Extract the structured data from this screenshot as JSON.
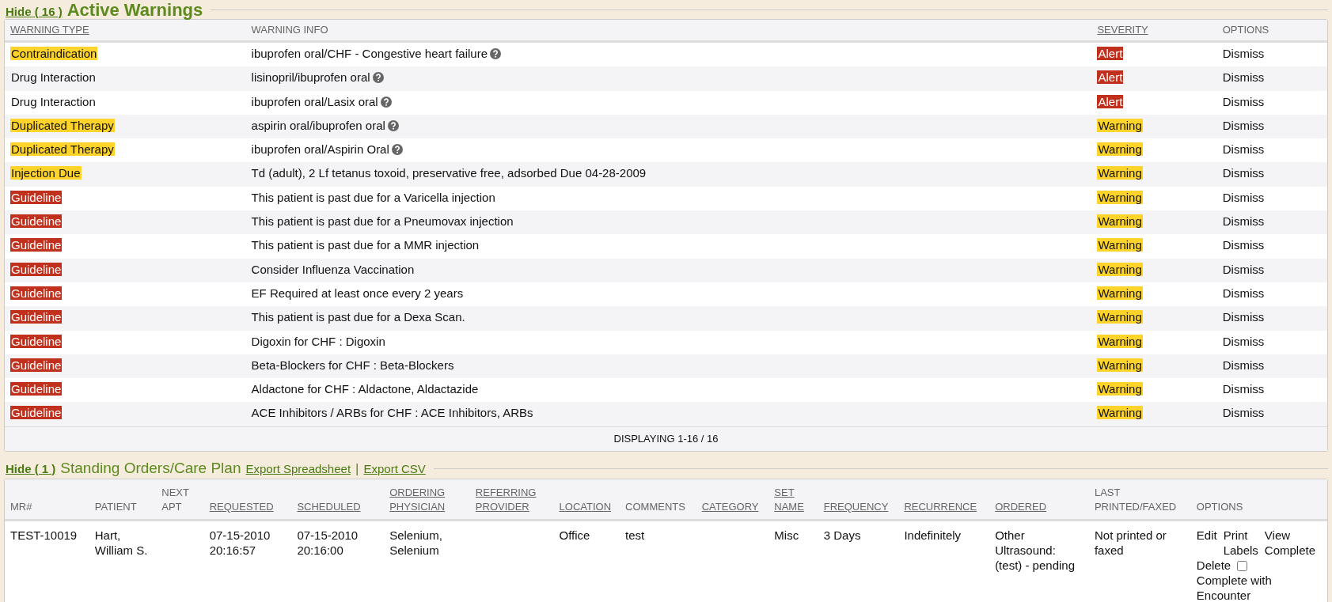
{
  "warnings": {
    "hide_link": "Hide ( 16 )",
    "title": "Active Warnings",
    "columns": [
      {
        "label": "WARNING TYPE",
        "sortable": true
      },
      {
        "label": "WARNING INFO",
        "sortable": false
      },
      {
        "label": "SEVERITY",
        "sortable": true
      },
      {
        "label": "OPTIONS",
        "sortable": false
      }
    ],
    "rows": [
      {
        "type": {
          "text": "Contraindication",
          "color": "#ffd42a"
        },
        "info": "ibuprofen oral/CHF - Congestive heart failure",
        "help": true,
        "severity": {
          "text": "Alert",
          "color": "#c0301c"
        },
        "option": "Dismiss"
      },
      {
        "type": {
          "text": "Drug Interaction"
        },
        "info": "lisinopril/ibuprofen oral",
        "help": true,
        "severity": {
          "text": "Alert",
          "color": "#c0301c"
        },
        "option": "Dismiss"
      },
      {
        "type": {
          "text": "Drug Interaction"
        },
        "info": "ibuprofen oral/Lasix oral",
        "help": true,
        "severity": {
          "text": "Alert",
          "color": "#c0301c"
        },
        "option": "Dismiss"
      },
      {
        "type": {
          "text": "Duplicated Therapy",
          "color": "#ffd42a"
        },
        "info": "aspirin oral/ibuprofen oral",
        "help": true,
        "severity": {
          "text": "Warning",
          "color": "#ffd42a"
        },
        "option": "Dismiss"
      },
      {
        "type": {
          "text": "Duplicated Therapy",
          "color": "#ffd42a"
        },
        "info": "ibuprofen oral/Aspirin Oral",
        "help": true,
        "severity": {
          "text": "Warning",
          "color": "#ffd42a"
        },
        "option": "Dismiss"
      },
      {
        "type": {
          "text": "Injection Due",
          "color": "#ffd42a"
        },
        "info": "Td (adult), 2 Lf tetanus toxoid, preservative free, adsorbed Due 04-28-2009",
        "help": false,
        "severity": {
          "text": "Warning",
          "color": "#ffd42a"
        },
        "option": "Dismiss"
      },
      {
        "type": {
          "text": "Guideline",
          "color": "#c0301c"
        },
        "info": "This patient is past due for a Varicella injection",
        "help": false,
        "severity": {
          "text": "Warning",
          "color": "#ffd42a"
        },
        "option": "Dismiss"
      },
      {
        "type": {
          "text": "Guideline",
          "color": "#c0301c"
        },
        "info": "This patient is past due for a Pneumovax injection",
        "help": false,
        "severity": {
          "text": "Warning",
          "color": "#ffd42a"
        },
        "option": "Dismiss"
      },
      {
        "type": {
          "text": "Guideline",
          "color": "#c0301c"
        },
        "info": "This patient is past due for a MMR injection",
        "help": false,
        "severity": {
          "text": "Warning",
          "color": "#ffd42a"
        },
        "option": "Dismiss"
      },
      {
        "type": {
          "text": "Guideline",
          "color": "#c0301c"
        },
        "info": "Consider Influenza Vaccination",
        "help": false,
        "severity": {
          "text": "Warning",
          "color": "#ffd42a"
        },
        "option": "Dismiss"
      },
      {
        "type": {
          "text": "Guideline",
          "color": "#c0301c"
        },
        "info": "EF Required at least once every 2 years",
        "help": false,
        "severity": {
          "text": "Warning",
          "color": "#ffd42a"
        },
        "option": "Dismiss"
      },
      {
        "type": {
          "text": "Guideline",
          "color": "#c0301c"
        },
        "info": "This patient is past due for a Dexa Scan.",
        "help": false,
        "severity": {
          "text": "Warning",
          "color": "#ffd42a"
        },
        "option": "Dismiss"
      },
      {
        "type": {
          "text": "Guideline",
          "color": "#c0301c"
        },
        "info": "Digoxin for CHF : Digoxin",
        "help": false,
        "severity": {
          "text": "Warning",
          "color": "#ffd42a"
        },
        "option": "Dismiss"
      },
      {
        "type": {
          "text": "Guideline",
          "color": "#c0301c"
        },
        "info": "Beta-Blockers for CHF : Beta-Blockers",
        "help": false,
        "severity": {
          "text": "Warning",
          "color": "#ffd42a"
        },
        "option": "Dismiss"
      },
      {
        "type": {
          "text": "Guideline",
          "color": "#c0301c"
        },
        "info": "Aldactone for CHF : Aldactone, Aldactazide",
        "help": false,
        "severity": {
          "text": "Warning",
          "color": "#ffd42a"
        },
        "option": "Dismiss"
      },
      {
        "type": {
          "text": "Guideline",
          "color": "#c0301c"
        },
        "info": "ACE Inhibitors / ARBs for CHF : ACE Inhibitors, ARBs",
        "help": false,
        "severity": {
          "text": "Warning",
          "color": "#ffd42a"
        },
        "option": "Dismiss"
      }
    ],
    "footer": "DISPLAYING 1-16 / 16"
  },
  "orders": {
    "hide_link": "Hide ( 1 )",
    "title": "Standing Orders/Care Plan",
    "export_links": [
      "Export Spreadsheet",
      "Export CSV"
    ],
    "separator": "|",
    "columns": [
      {
        "label": "MR#",
        "sortable": false
      },
      {
        "label": "PATIENT",
        "sortable": false
      },
      {
        "label": "NEXT APT",
        "sortable": false
      },
      {
        "label": "REQUESTED",
        "sortable": true
      },
      {
        "label": "SCHEDULED",
        "sortable": true
      },
      {
        "label": "ORDERING PHYSICIAN",
        "sortable": true
      },
      {
        "label": "REFERRING PROVIDER",
        "sortable": true
      },
      {
        "label": "LOCATION",
        "sortable": true
      },
      {
        "label": "COMMENTS",
        "sortable": false
      },
      {
        "label": "CATEGORY",
        "sortable": true
      },
      {
        "label": "SET NAME",
        "sortable": true
      },
      {
        "label": "FREQUENCY",
        "sortable": true
      },
      {
        "label": "RECURRENCE",
        "sortable": true
      },
      {
        "label": "ORDERED",
        "sortable": true
      },
      {
        "label": "LAST PRINTED/FAXED",
        "sortable": false
      },
      {
        "label": "OPTIONS",
        "sortable": false
      }
    ],
    "rows": [
      {
        "cells": [
          "TEST-10019",
          "Hart, William S.",
          null,
          "07-15-2010 20:16:57",
          "07-15-2010 20:16:00",
          "Selenium, Selenium",
          null,
          "Office",
          "test",
          null,
          "Misc",
          "3 Days",
          "Indefinitely",
          "Other Ultrasound: (test) - pending",
          "Not printed or faxed"
        ],
        "options": {
          "links": [
            "Edit",
            "Print Labels",
            "View Complete",
            "Delete"
          ],
          "complete_checkbox": {
            "label": "Complete with Encounter",
            "checked": false
          }
        }
      }
    ]
  }
}
